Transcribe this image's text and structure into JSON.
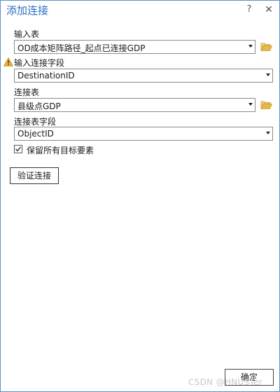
{
  "window": {
    "title": "添加连接",
    "help_label": "?",
    "close_label": "✕"
  },
  "fields": {
    "input_table": {
      "label": "输入表",
      "value": "OD成本矩阵路径_起点已连接GDP"
    },
    "input_join_field": {
      "label": "输入连接字段",
      "value": "DestinationID",
      "warning": true
    },
    "join_table": {
      "label": "连接表",
      "value": "县级点GDP"
    },
    "join_table_field": {
      "label": "连接表字段",
      "value": "ObjectID"
    }
  },
  "options": {
    "keep_all_target_features": {
      "label": "保留所有目标要素",
      "checked": true
    }
  },
  "buttons": {
    "validate_label": "验证连接",
    "ok_label": "确定"
  },
  "watermark": "CSDN @HNUSTer",
  "icons": {
    "warning": "warning-triangle-icon",
    "folder": "folder-open-icon",
    "dropdown": "chevron-down-icon",
    "check": "checkmark-icon"
  },
  "colors": {
    "title": "#2b6fbf",
    "window_border": "#5a8fc9",
    "folder": "#e8b84a",
    "warning": "#f2b632"
  }
}
